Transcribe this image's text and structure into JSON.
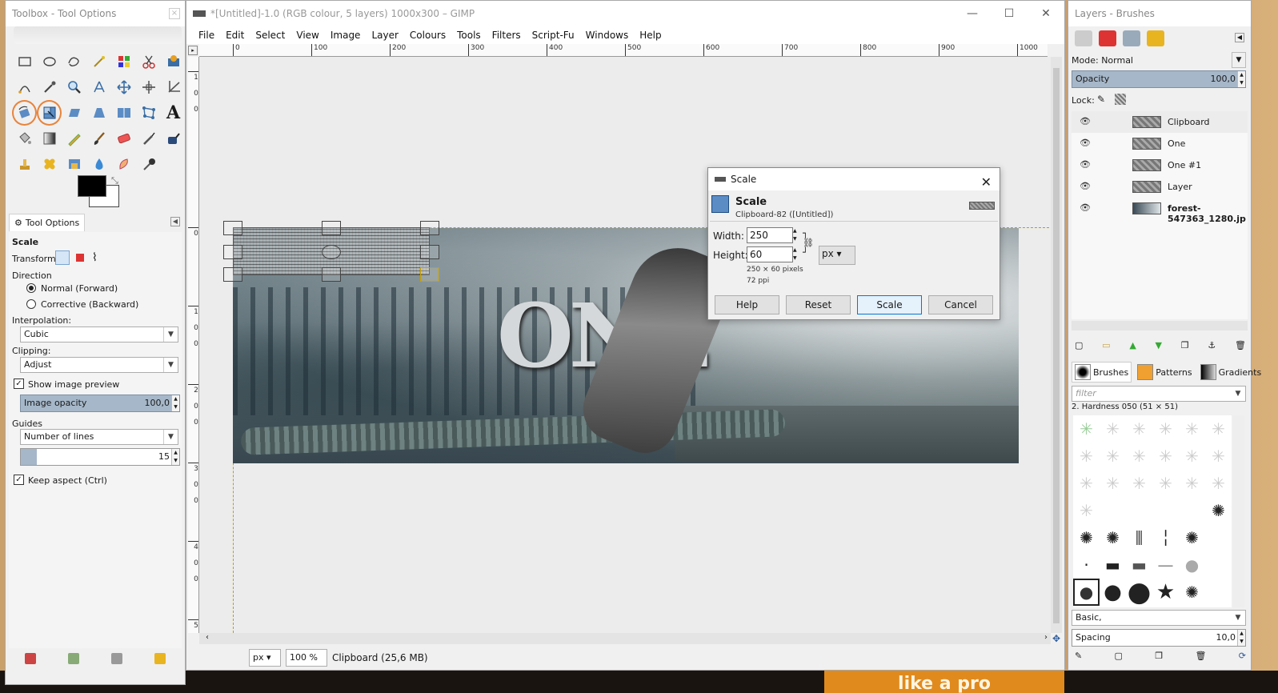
{
  "toolbox": {
    "title": "Toolbox - Tool Options",
    "tab_label": "Tool Options",
    "tool_name": "Scale",
    "transform_label": "Transform:",
    "direction_label": "Direction",
    "direction_normal": "Normal (Forward)",
    "direction_corrective": "Corrective (Backward)",
    "interpolation_label": "Interpolation:",
    "interpolation_value": "Cubic",
    "clipping_label": "Clipping:",
    "clipping_value": "Adjust",
    "show_preview_label": "Show image preview",
    "image_opacity_label": "Image opacity",
    "image_opacity_value": "100,0",
    "guides_label": "Guides",
    "guides_value": "Number of lines",
    "guides_count": "15",
    "keep_aspect_label": "Keep aspect  (Ctrl)",
    "foreground_color": "#000000",
    "background_color": "#ffffff",
    "highlight_color": "#e8843c"
  },
  "main": {
    "title": "*[Untitled]-1.0 (RGB colour, 5 layers) 1000x300 – GIMP",
    "menu": [
      "File",
      "Edit",
      "Select",
      "View",
      "Image",
      "Layer",
      "Colours",
      "Tools",
      "Filters",
      "Script-Fu",
      "Windows",
      "Help"
    ],
    "ruler_ticks": [
      "0",
      "100",
      "200",
      "300",
      "400",
      "500",
      "600",
      "700",
      "800",
      "900",
      "1000"
    ],
    "vruler_ticks": [
      "1 0 0",
      "0",
      "1 0 0",
      "2 0 0",
      "3 0 0",
      "4 0 0",
      "5"
    ],
    "image_text": "ONE",
    "status": {
      "unit": "px",
      "zoom": "100 %",
      "message": "Clipboard (25,6 MB)"
    }
  },
  "scale_dialog": {
    "title": "Scale",
    "header": "Scale",
    "subheader": "Clipboard-82 ([Untitled])",
    "width_label": "Width:",
    "width_value": "250",
    "height_label": "Height:",
    "height_value": "60",
    "unit": "px",
    "size_info": "250 × 60 pixels",
    "resolution_info": "72 ppi",
    "help_label": "Help",
    "reset_label": "Reset",
    "scale_label": "Scale",
    "cancel_label": "Cancel"
  },
  "layers": {
    "title": "Layers - Brushes",
    "mode_label": "Mode:",
    "mode_value": "Normal",
    "opacity_label": "Opacity",
    "opacity_value": "100,0",
    "lock_label": "Lock:",
    "items": [
      {
        "name": "Clipboard"
      },
      {
        "name": "One"
      },
      {
        "name": "One #1"
      },
      {
        "name": "Layer"
      },
      {
        "name": "forest-547363_1280.jp"
      }
    ]
  },
  "brushes": {
    "tabs": [
      "Brushes",
      "Patterns",
      "Gradients"
    ],
    "filter_placeholder": "filter",
    "selected_brush": "2. Hardness 050 (51 × 51)",
    "preset_value": "Basic,",
    "spacing_label": "Spacing",
    "spacing_value": "10,0"
  },
  "desktop": {
    "promo_text": "like a pro"
  }
}
